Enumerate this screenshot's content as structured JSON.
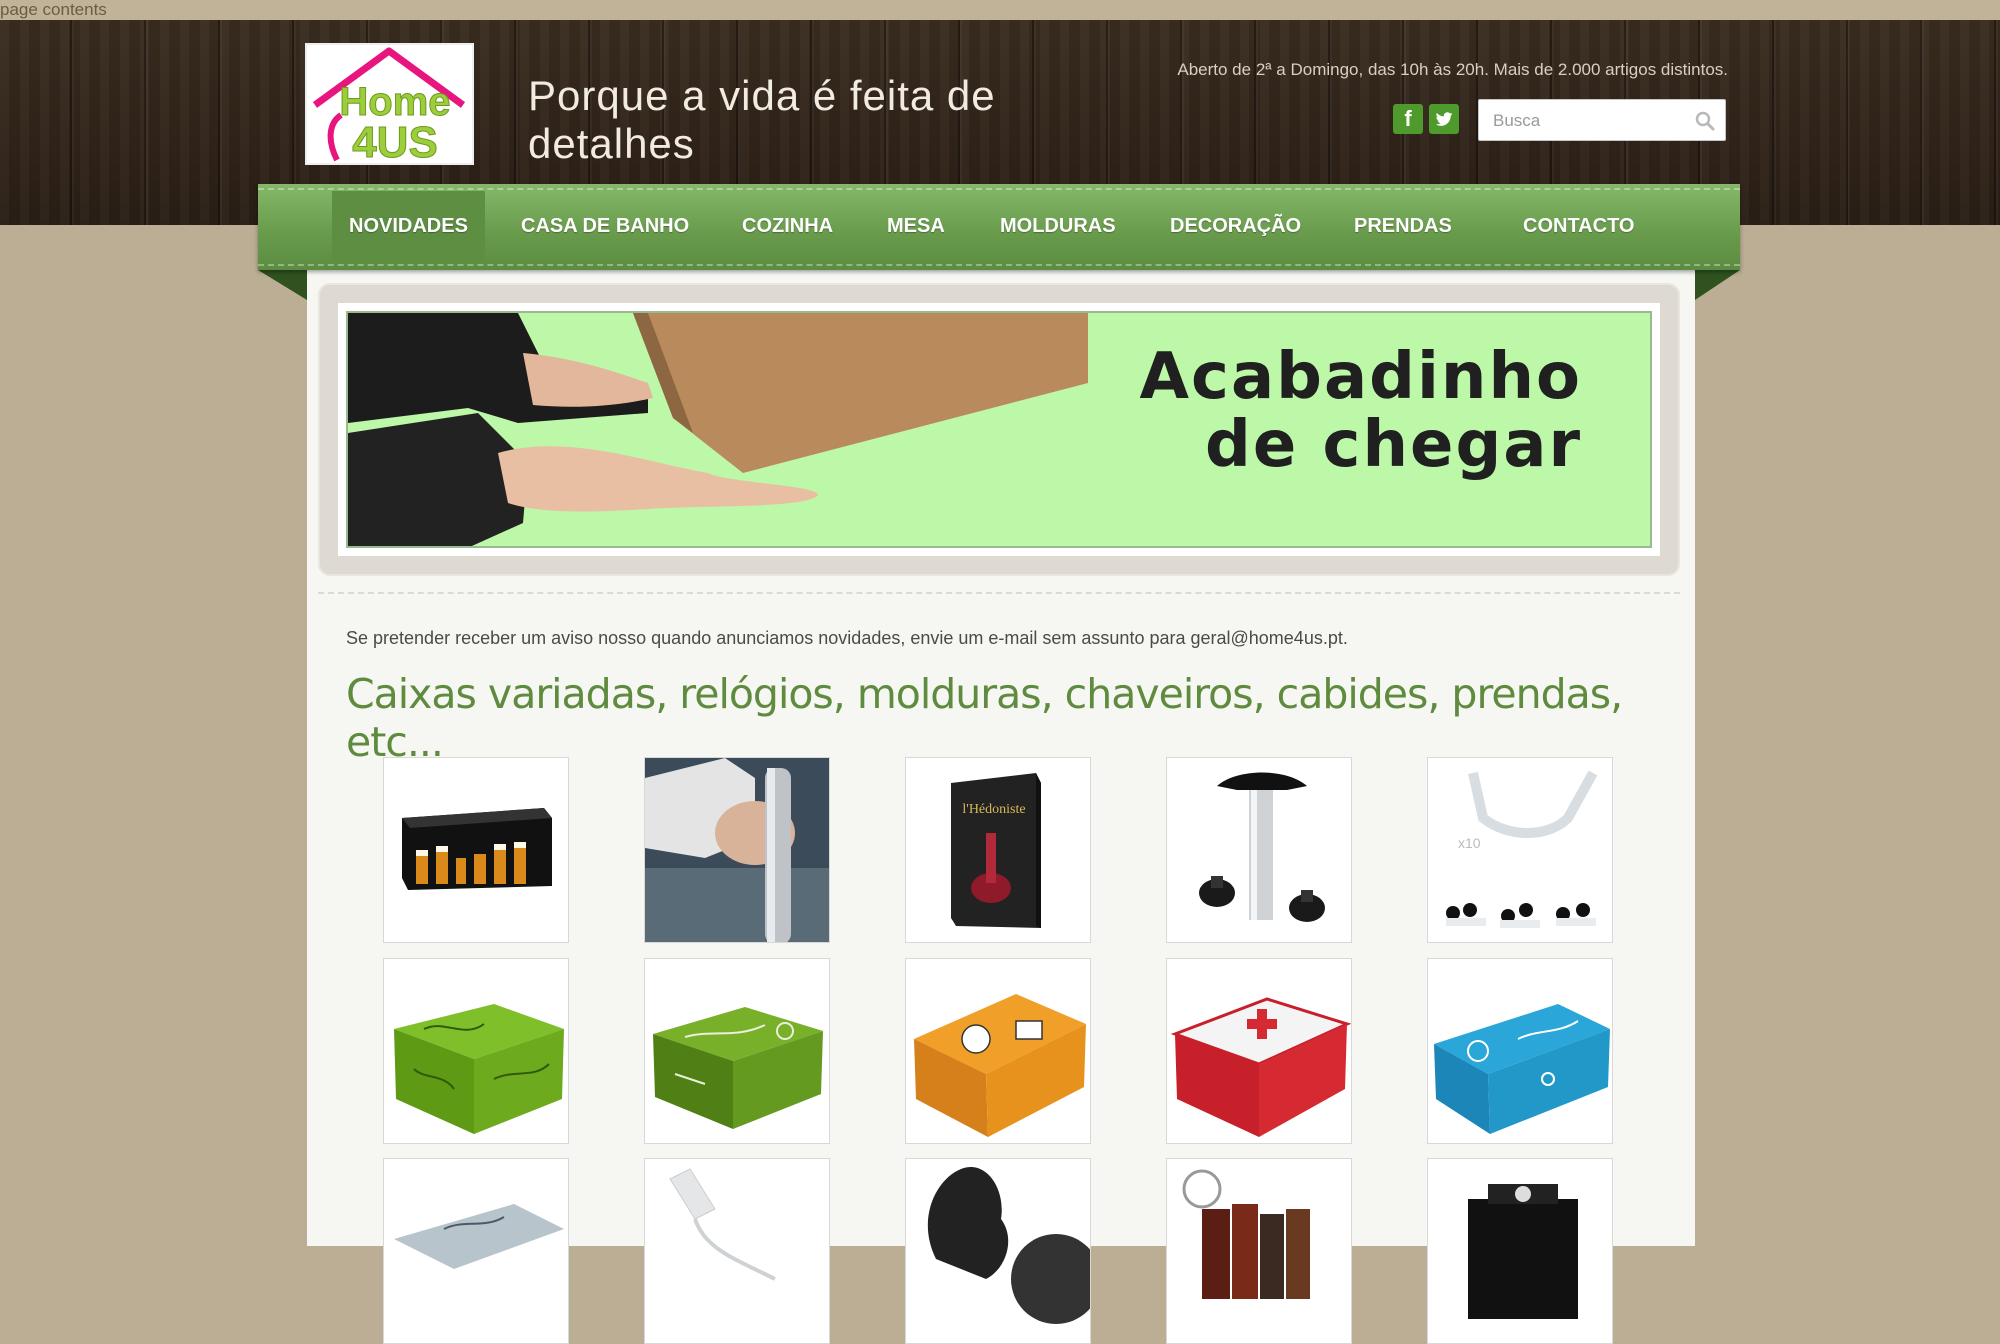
{
  "browser": {
    "tab_label": "page contents"
  },
  "header": {
    "logo_text_top": "Home",
    "logo_text_bottom": "4US",
    "tagline": "Porque a vida é feita de detalhes",
    "hours": "Aberto de 2ª a Domingo, das 10h às 20h. Mais de 2.000 artigos distintos.",
    "social": {
      "facebook": "f"
    },
    "search": {
      "placeholder": "Busca",
      "value": ""
    }
  },
  "nav": {
    "items": [
      {
        "label": "NOVIDADES",
        "active": true
      },
      {
        "label": "CASA DE BANHO"
      },
      {
        "label": "COZINHA"
      },
      {
        "label": "MESA"
      },
      {
        "label": "MOLDURAS"
      },
      {
        "label": "DECORAÇÃO"
      },
      {
        "label": "PRENDAS"
      },
      {
        "label": "CONTACTO"
      }
    ]
  },
  "banner": {
    "line1": "Acabadinho",
    "line2": "de chegar"
  },
  "main": {
    "notice": "Se pretender receber um aviso nosso quando anunciamos novidades, envie um e-mail sem assunto para geral@home4us.pt.",
    "heading": "Caixas variadas, relógios, molduras, chaveiros, cabides, prendas, etc...",
    "product_box_labels": {
      "wine_box": "l'Hédoniste",
      "rack_label": "x10"
    }
  },
  "colors": {
    "nav_green": "#6a9c4d",
    "heading_green": "#5f8b3e",
    "banner_green": "#bdf7a8",
    "social_green": "#4e9a2c"
  }
}
